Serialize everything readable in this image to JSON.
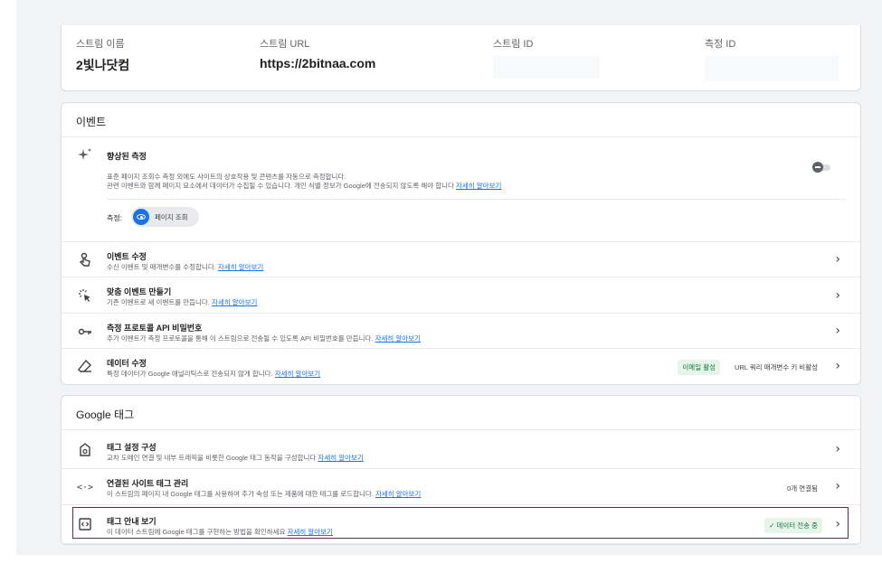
{
  "stream": {
    "name_label": "스트림 이름",
    "name_value": "2빛나닷컴",
    "url_label": "스트림 URL",
    "url_value": "https://2bitnaa.com",
    "id_label": "스트림 ID",
    "measure_label": "측정 ID"
  },
  "events": {
    "header": "이벤트",
    "enhanced": {
      "title": "향상된 측정",
      "desc1": "표준 페이지 조회수 측정 외에도 사이트의 상호작용 및 콘텐츠를 자동으로 측정합니다.",
      "desc2": "관련 이벤트와 함께 페이지 요소에서 데이터가 수집될 수 있습니다. 개인 식별 정보가 Google에 전송되지 않도록 해야 합니다",
      "link": "자세히 알아보기",
      "measure_label": "측정:",
      "chip_label": "페이지 조회"
    },
    "rows": [
      {
        "title": "이벤트 수정",
        "desc": "수신 이벤트 및 매개변수를 수정합니다.",
        "link": "자세히 알아보기"
      },
      {
        "title": "맞춤 이벤트 만들기",
        "desc": "기존 이벤트로 새 이벤트를 만듭니다.",
        "link": "자세히 알아보기"
      },
      {
        "title": "측정 프로토콜 API 비밀번호",
        "desc": "추가 이벤트가 측정 프로토콜을 통해 이 스트림으로 전송될 수 있도록 API 비밀번호를 만듭니다.",
        "link": "자세히 알아보기"
      },
      {
        "title": "데이터 수정",
        "desc": "특정 데이터가 Google 애널리틱스로 전송되지 않게 합니다.",
        "link": "자세히 알아보기",
        "badge_green": "이메일 활성",
        "badge_gray": "URL 쿼리 매개변수 키 비활성"
      }
    ]
  },
  "gtag": {
    "header": "Google 태그",
    "rows": [
      {
        "title": "태그 설정 구성",
        "desc": "교차 도메인 연결 및 내부 트래픽을 비롯한 Google 태그 동작을 구성합니다",
        "link": "자세히 알아보기"
      },
      {
        "title": "연결된 사이트 태그 관리",
        "desc": "이 스트림의 페이지 내 Google 태그를 사용하여 추가 속성 또는 제품에 대한 태그를 로드합니다.",
        "link": "자세히 알아보기",
        "badge_gray": "0개 연결됨"
      },
      {
        "title": "태그 안내 보기",
        "desc": "이 데이터 스트림에 Google 태그를 구현하는 방법을 확인하세요",
        "link": "자세히 알아보기",
        "badge_green": "✓ 데이터 전송 중"
      }
    ]
  },
  "colors": {
    "accent": "#1a73e8",
    "success_bg": "#e6f4ea",
    "success_text": "#137333",
    "selected_border": "#5c2d5e"
  }
}
